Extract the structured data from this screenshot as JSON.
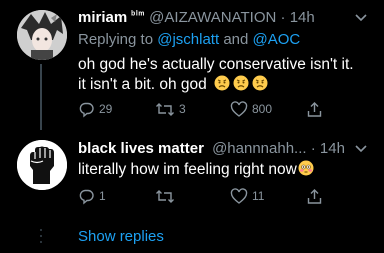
{
  "tweet1": {
    "display_name": "miriam",
    "badge": "ᵇˡᵐ",
    "handle": "@AIZAWANATION",
    "separator": "·",
    "time": "14h",
    "replying_prefix": "Replying to",
    "reply_mention_1": "@jschlatt",
    "reply_and": "and",
    "reply_mention_2": "@AOC",
    "text_line_1": "oh god he's actually conservative isn't it.",
    "text_line_2": "it isn't a bit. oh god",
    "emojis": [
      "worried-face-emoji",
      "worried-face-emoji",
      "worried-face-emoji"
    ],
    "reply_count": "29",
    "retweet_count": "3",
    "like_count": "800"
  },
  "tweet2": {
    "display_name": "black lives matter",
    "handle": "@hannnahh...",
    "separator": "·",
    "time": "14h",
    "text": "literally how im feeling right now",
    "emoji": "flushed-face-emoji",
    "reply_count": "1",
    "retweet_count": "",
    "like_count": "11"
  },
  "show_replies": "Show replies",
  "colors": {
    "background": "#000000",
    "text": "#ffffff",
    "muted": "#8a959e",
    "link": "#1da1f2",
    "divider": "#38444d"
  }
}
